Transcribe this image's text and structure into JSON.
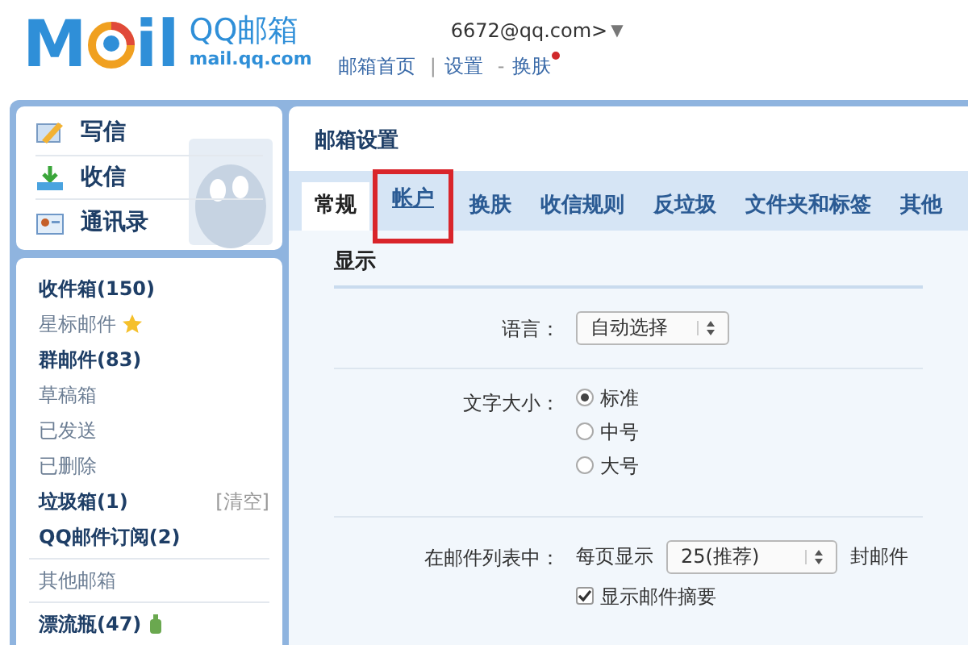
{
  "header": {
    "logo": {
      "left": "M",
      "right": "il"
    },
    "brand": "QQ邮箱",
    "domain": "mail.qq.com",
    "account": "6672@qq.com>",
    "account_caret": "▼",
    "nav": [
      {
        "text": "邮箱首页",
        "kind": "link",
        "new_dot": false
      },
      {
        "text": "|",
        "kind": "sep"
      },
      {
        "text": "设置",
        "kind": "link",
        "new_dot": false
      },
      {
        "text": "-",
        "kind": "sep"
      },
      {
        "text": "换肤",
        "kind": "link",
        "new_dot": true
      }
    ]
  },
  "actions": [
    {
      "label": "写信"
    },
    {
      "label": "收信"
    },
    {
      "label": "通讯录"
    }
  ],
  "folder_groups": [
    [
      {
        "label": "收件箱(150)",
        "unread": true,
        "kind": "folder"
      },
      {
        "label": "星标邮件",
        "unread": false,
        "kind": "starred"
      },
      {
        "label": "群邮件(83)",
        "unread": true,
        "kind": "folder"
      },
      {
        "label": "草稿箱",
        "unread": false,
        "kind": "folder"
      },
      {
        "label": "已发送",
        "unread": false,
        "kind": "folder"
      },
      {
        "label": "已删除",
        "unread": false,
        "kind": "folder"
      },
      {
        "label": "垃圾箱(1)",
        "unread": true,
        "kind": "folder",
        "action": "[清空]"
      },
      {
        "label": "QQ邮件订阅(2)",
        "unread": true,
        "kind": "folder"
      }
    ],
    [
      {
        "label": "其他邮箱",
        "unread": false,
        "kind": "folder"
      }
    ],
    [
      {
        "label": "漂流瓶(47)",
        "unread": true,
        "kind": "bottle"
      }
    ]
  ],
  "settings": {
    "title": "邮箱设置",
    "tabs": [
      {
        "label": "常规",
        "selected": true,
        "highlighted": false
      },
      {
        "label": "帐户",
        "selected": false,
        "highlighted": true
      },
      {
        "label": "换肤",
        "selected": false,
        "highlighted": false
      },
      {
        "label": "收信规则",
        "selected": false,
        "highlighted": false
      },
      {
        "label": "反垃圾",
        "selected": false,
        "highlighted": false
      },
      {
        "label": "文件夹和标签",
        "selected": false,
        "highlighted": false
      },
      {
        "label": "其他",
        "selected": false,
        "highlighted": false
      }
    ],
    "section": "显示",
    "rows": [
      {
        "kind": "select",
        "label": "语言：",
        "value": "自动选择"
      },
      {
        "kind": "radio",
        "label": "文字大小：",
        "options": [
          {
            "label": "标准",
            "selected": true
          },
          {
            "label": "中号",
            "selected": false
          },
          {
            "label": "大号",
            "selected": false
          }
        ]
      },
      {
        "kind": "list",
        "label": "在邮件列表中：",
        "prefix": "每页显示",
        "value": "25(推荐)",
        "suffix": "封邮件",
        "checkbox": {
          "label": "显示邮件摘要",
          "checked": true
        }
      }
    ]
  }
}
